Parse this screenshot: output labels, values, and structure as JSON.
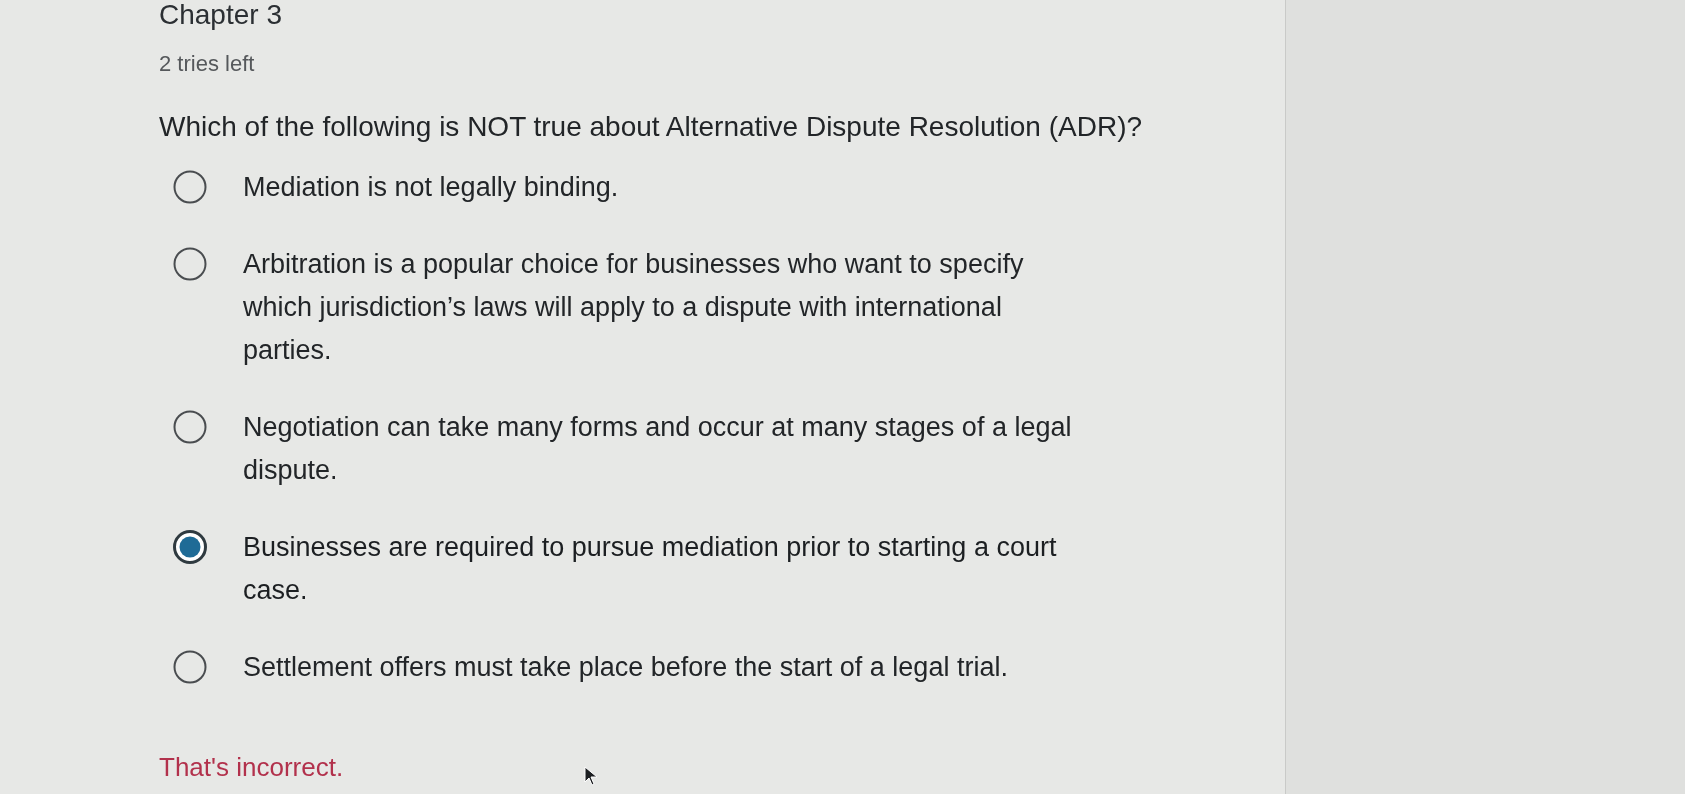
{
  "heading": "Chapter 3",
  "tries_left": "2 tries left",
  "question": "Which of the following is NOT true about Alternative Dispute Resolution (ADR)?",
  "options": [
    {
      "label": "Mediation is not legally binding.",
      "selected": false
    },
    {
      "label": "Arbitration is a popular choice for businesses who want to specify which jurisdiction’s laws will apply to a dispute with international parties.",
      "selected": false
    },
    {
      "label": "Negotiation can take many forms and occur at many stages of a legal dispute.",
      "selected": false
    },
    {
      "label": "Businesses are required to pursue mediation prior to starting a court case.",
      "selected": true
    },
    {
      "label": "Settlement offers must take place before the start of a legal trial.",
      "selected": false
    }
  ],
  "feedback": "That's incorrect."
}
